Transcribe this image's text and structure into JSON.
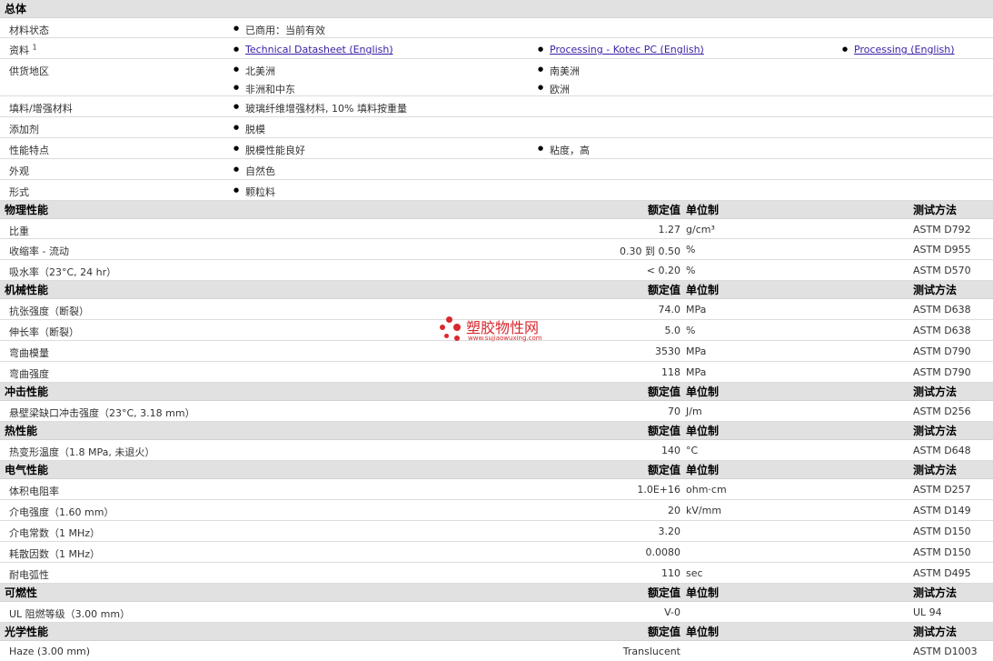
{
  "general": {
    "title": "总体",
    "rows": [
      {
        "label": "材料状态",
        "items": [
          "已商用：当前有效"
        ]
      },
      {
        "label": "资料",
        "sup": "1",
        "links": [
          "Technical Datasheet (English)",
          "Processing - Kotec PC (English)",
          "Processing (English)"
        ]
      },
      {
        "label": "供货地区",
        "items": [
          "北美洲",
          "南美洲",
          "非洲和中东",
          "欧洲"
        ]
      },
      {
        "label": "填料/增强材料",
        "items": [
          "玻璃纤维增强材料, 10% 填料按重量"
        ]
      },
      {
        "label": "添加剂",
        "items": [
          "脱模"
        ]
      },
      {
        "label": "性能特点",
        "items": [
          "脱模性能良好",
          "粘度，高"
        ]
      },
      {
        "label": "外观",
        "items": [
          "自然色"
        ]
      },
      {
        "label": "形式",
        "items": [
          "颗粒料"
        ]
      }
    ]
  },
  "col_headers": {
    "value": "额定值",
    "unit": "单位制",
    "test": "测试方法"
  },
  "sections": [
    {
      "title": "物理性能",
      "rows": [
        {
          "label": "比重",
          "value": "1.27",
          "unit": "g/cm³",
          "test": "ASTM D792"
        },
        {
          "label": "收缩率 - 流动",
          "value": "0.30 到  0.50",
          "unit": "%",
          "test": "ASTM D955"
        },
        {
          "label": "吸水率（23°C, 24 hr）",
          "value": "< 0.20",
          "unit": "%",
          "test": "ASTM D570"
        }
      ]
    },
    {
      "title": "机械性能",
      "rows": [
        {
          "label": "抗张强度（断裂）",
          "value": "74.0",
          "unit": "MPa",
          "test": "ASTM D638"
        },
        {
          "label": "伸长率（断裂）",
          "value": "5.0",
          "unit": "%",
          "test": "ASTM D638"
        },
        {
          "label": "弯曲模量",
          "value": "3530",
          "unit": "MPa",
          "test": "ASTM D790"
        },
        {
          "label": "弯曲强度",
          "value": "118",
          "unit": "MPa",
          "test": "ASTM D790"
        }
      ]
    },
    {
      "title": "冲击性能",
      "rows": [
        {
          "label": "悬壁梁缺口冲击强度（23°C, 3.18 mm）",
          "value": "70",
          "unit": "J/m",
          "test": "ASTM D256"
        }
      ]
    },
    {
      "title": "热性能",
      "rows": [
        {
          "label": "热变形温度（1.8 MPa, 未退火）",
          "value": "140",
          "unit": "°C",
          "test": "ASTM D648"
        }
      ]
    },
    {
      "title": "电气性能",
      "rows": [
        {
          "label": "体积电阻率",
          "value": "1.0E+16",
          "unit": "ohm·cm",
          "test": "ASTM D257"
        },
        {
          "label": "介电强度（1.60 mm）",
          "value": "20",
          "unit": "kV/mm",
          "test": "ASTM D149"
        },
        {
          "label": "介电常数（1 MHz）",
          "value": "3.20",
          "unit": "",
          "test": "ASTM D150"
        },
        {
          "label": "耗散因数（1 MHz）",
          "value": "0.0080",
          "unit": "",
          "test": "ASTM D150"
        },
        {
          "label": "耐电弧性",
          "value": "110",
          "unit": "sec",
          "test": "ASTM D495"
        }
      ]
    },
    {
      "title": "可燃性",
      "rows": [
        {
          "label": "UL 阻燃等级（3.00 mm）",
          "value": "V-0",
          "unit": "",
          "test": "UL 94"
        }
      ]
    },
    {
      "title": "光学性能",
      "rows": [
        {
          "label": "Haze (3.00 mm)",
          "value": "Translucent",
          "unit": "",
          "test": "ASTM D1003"
        }
      ]
    }
  ],
  "watermark": {
    "title": "塑胶物性网",
    "url": "www.sujiaowuxing.com"
  }
}
